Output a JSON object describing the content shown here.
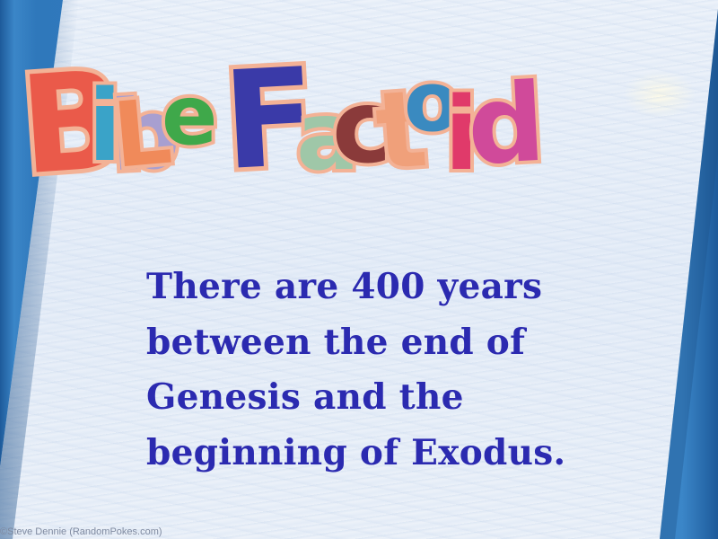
{
  "title": {
    "word1": "Bible",
    "word2": "Factoid",
    "letters": [
      {
        "char": "B",
        "color": "#ea5a4a"
      },
      {
        "char": "i",
        "color": "#3aa3c8"
      },
      {
        "char": "b",
        "color": "#a89fd0"
      },
      {
        "char": "L",
        "color": "#f08a5a"
      },
      {
        "char": "e",
        "color": "#3fa84a"
      },
      {
        "char": "F",
        "color": "#3a3aa8"
      },
      {
        "char": "a",
        "color": "#9fc7a8"
      },
      {
        "char": "c",
        "color": "#8a3a3a"
      },
      {
        "char": "t",
        "color": "#f0a07a"
      },
      {
        "char": "o",
        "color": "#3a8ac0"
      },
      {
        "char": "i",
        "color": "#e03a6a"
      },
      {
        "char": "d",
        "color": "#d04a9a"
      }
    ]
  },
  "fact": {
    "lines": [
      "There are 400 years",
      "between the end of",
      "Genesis and the",
      "beginning of Exodus."
    ]
  },
  "credit": "©Steve Dennie (RandomPokes.com)"
}
